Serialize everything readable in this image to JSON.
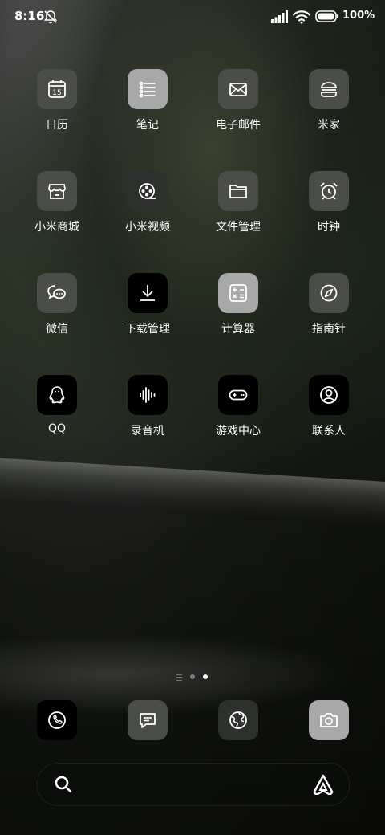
{
  "status": {
    "time": "8:16",
    "battery": "100%"
  },
  "apps": [
    {
      "label": "日历",
      "icon": "calendar-icon",
      "day": "15"
    },
    {
      "label": "笔记",
      "icon": "notes-icon"
    },
    {
      "label": "电子邮件",
      "icon": "mail-icon"
    },
    {
      "label": "米家",
      "icon": "mijia-icon"
    },
    {
      "label": "小米商城",
      "icon": "store-icon"
    },
    {
      "label": "小米视频",
      "icon": "video-reel-icon"
    },
    {
      "label": "文件管理",
      "icon": "folder-icon"
    },
    {
      "label": "时钟",
      "icon": "alarm-clock-icon"
    },
    {
      "label": "微信",
      "icon": "chat-bubbles-icon"
    },
    {
      "label": "下载管理",
      "icon": "download-icon"
    },
    {
      "label": "计算器",
      "icon": "calculator-icon"
    },
    {
      "label": "指南针",
      "icon": "compass-icon"
    },
    {
      "label": "QQ",
      "icon": "penguin-icon"
    },
    {
      "label": "录音机",
      "icon": "waveform-icon"
    },
    {
      "label": "游戏中心",
      "icon": "gamepad-icon"
    },
    {
      "label": "联系人",
      "icon": "contact-icon"
    }
  ],
  "dock": [
    {
      "icon": "phone-icon"
    },
    {
      "icon": "message-icon"
    },
    {
      "icon": "browser-globe-icon"
    },
    {
      "icon": "camera-icon"
    }
  ],
  "pager": {
    "pages": 2,
    "current": 2
  }
}
